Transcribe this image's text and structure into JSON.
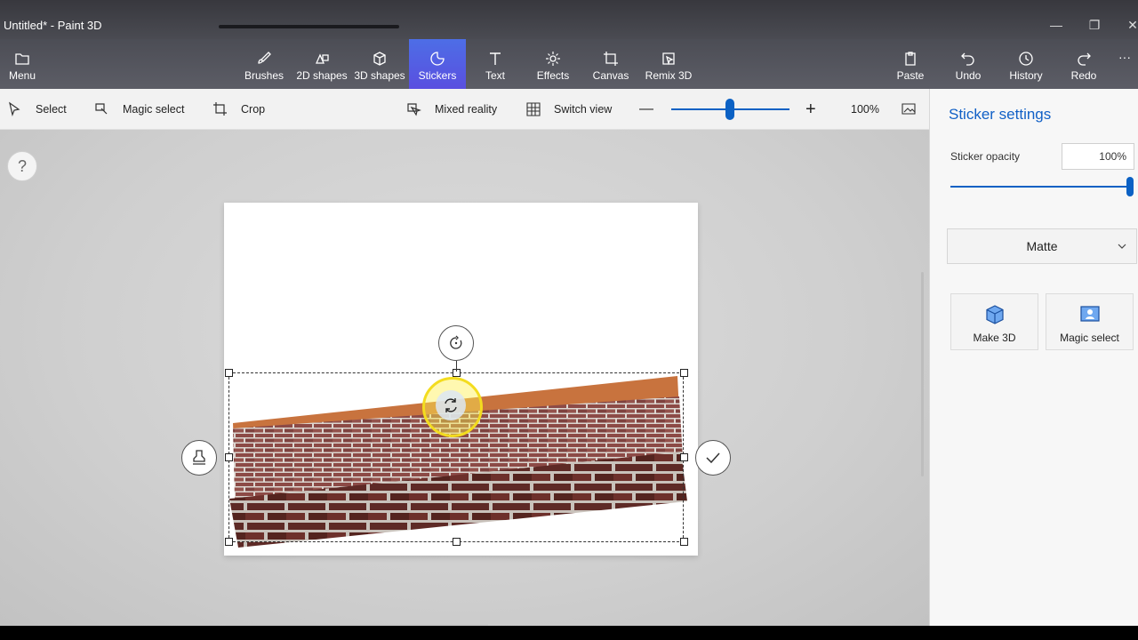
{
  "window": {
    "title": "Untitled* - Paint 3D",
    "minimize": "—",
    "restore": "❐",
    "close": "✕"
  },
  "ribbon": {
    "menu": "Menu",
    "tabs": [
      {
        "label": "Brushes",
        "icon": "brush-icon"
      },
      {
        "label": "2D shapes",
        "icon": "2d-shapes-icon"
      },
      {
        "label": "3D shapes",
        "icon": "3d-shapes-icon"
      },
      {
        "label": "Stickers",
        "icon": "stickers-icon",
        "active": true
      },
      {
        "label": "Text",
        "icon": "text-icon"
      },
      {
        "label": "Effects",
        "icon": "effects-icon"
      },
      {
        "label": "Canvas",
        "icon": "canvas-icon"
      },
      {
        "label": "Remix 3D",
        "icon": "remix-3d-icon"
      }
    ],
    "actions": [
      {
        "label": "Paste",
        "icon": "paste-icon"
      },
      {
        "label": "Undo",
        "icon": "undo-icon"
      },
      {
        "label": "History",
        "icon": "history-icon"
      },
      {
        "label": "Redo",
        "icon": "redo-icon"
      }
    ],
    "more": "···"
  },
  "toolbar": {
    "select": "Select",
    "magic_select": "Magic select",
    "crop": "Crop",
    "mixed_reality": "Mixed reality",
    "switch_view": "Switch view",
    "zoom_out": "—",
    "zoom_in": "+",
    "zoom_level": "100%",
    "zoom_fraction": 0.5
  },
  "workspace": {
    "help": "?"
  },
  "panel": {
    "title": "Sticker settings",
    "opacity_label": "Sticker opacity",
    "opacity_value": "100%",
    "opacity_fraction": 1.0,
    "finish": "Matte",
    "make3d": "Make 3D",
    "magic_select": "Magic select"
  },
  "colors": {
    "accent": "#0b61c4",
    "active_tab": "#5060e0",
    "cursor_highlight": "#f3dc1f"
  }
}
